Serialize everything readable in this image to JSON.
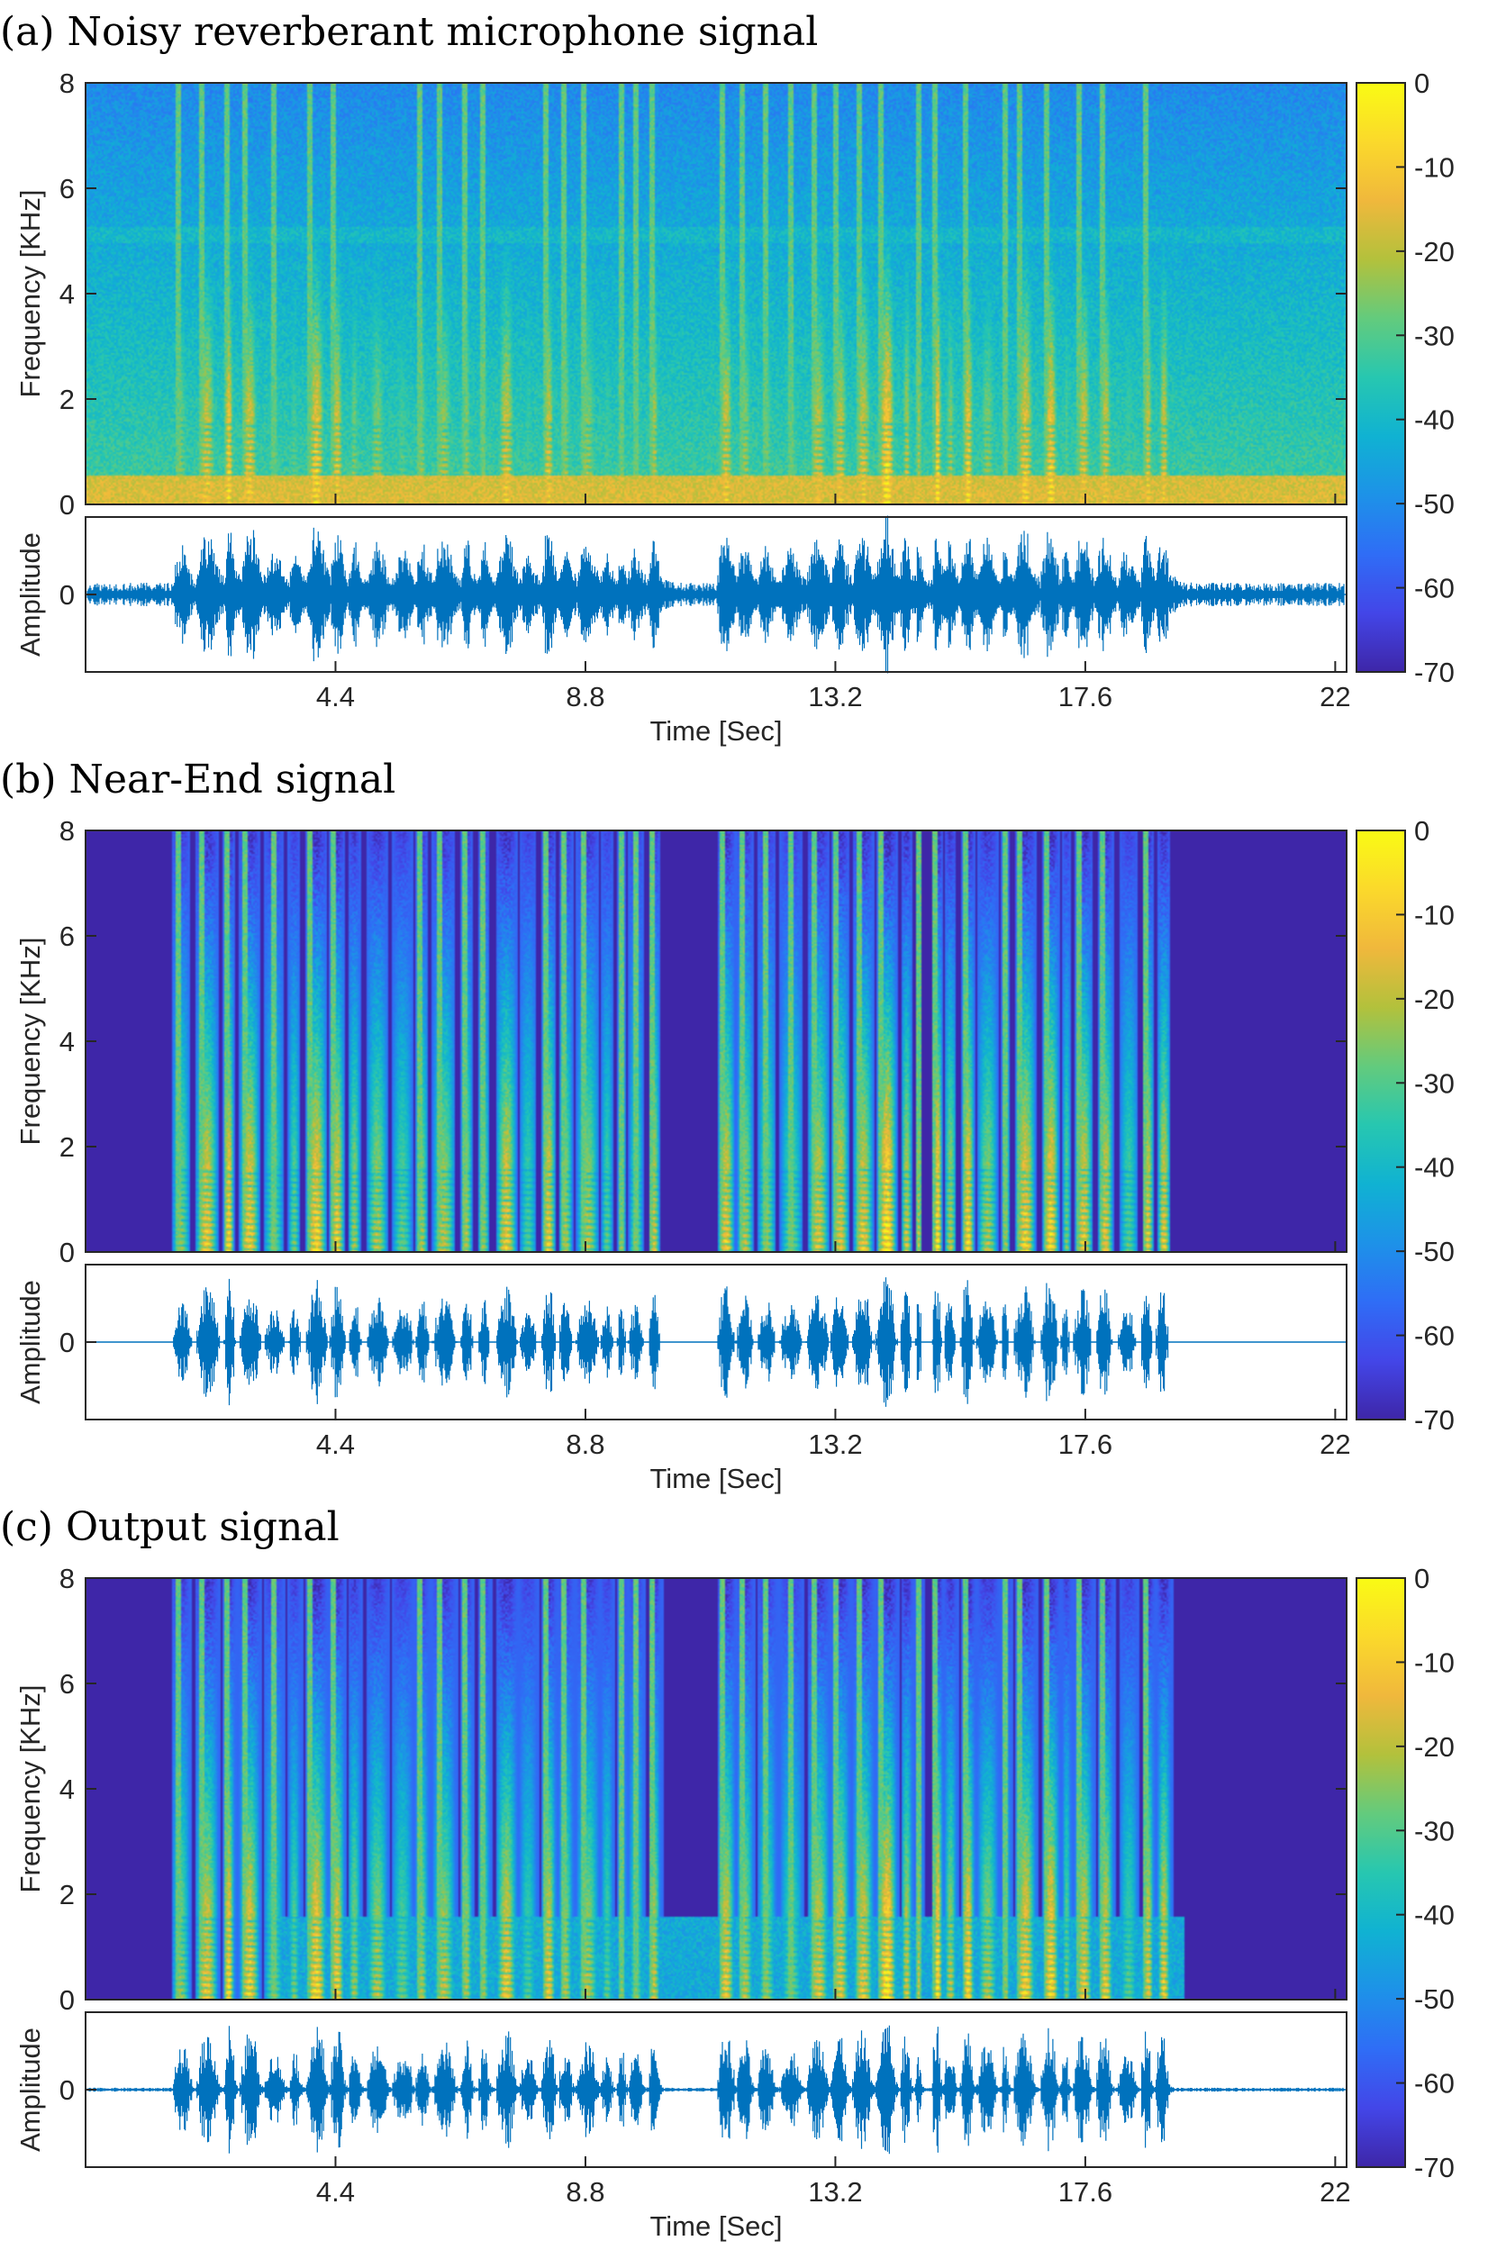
{
  "chart_data": [
    {
      "type": "spectrogram_with_waveform",
      "title": "(a)  Noisy reverberant microphone signal",
      "spectrogram": {
        "ylabel": "Frequency [KHz]",
        "ylim": [
          0,
          8
        ],
        "yticks": [
          "0",
          "2",
          "4",
          "6",
          "8"
        ],
        "background_db": -50,
        "noise_floor": true,
        "noise_level": 0.3,
        "reverb_tail": 0.7,
        "high_freq_noise_band": true
      },
      "waveform": {
        "ylabel": "Amplitude",
        "yticks": [
          "0"
        ],
        "noise_amplitude": 0.12,
        "reverb_tail": 0.7
      },
      "xlabel": "Time [Sec]",
      "xlim": [
        0,
        22.2
      ],
      "xticks": [
        "4.4",
        "8.8",
        "13.2",
        "17.6",
        "22"
      ],
      "colorbar": {
        "ticks": [
          "0",
          "-10",
          "-20",
          "-30",
          "-40",
          "-50",
          "-60",
          "-70"
        ],
        "clim": [
          -70,
          0
        ]
      }
    },
    {
      "type": "spectrogram_with_waveform",
      "title": "(b)  Near-End signal",
      "spectrogram": {
        "ylabel": "Frequency [KHz]",
        "ylim": [
          0,
          8
        ],
        "yticks": [
          "0",
          "2",
          "4",
          "6",
          "8"
        ],
        "background_db": -70,
        "noise_floor": false,
        "noise_level": 0.0,
        "reverb_tail": 0.0,
        "high_freq_noise_band": false
      },
      "waveform": {
        "ylabel": "Amplitude",
        "yticks": [
          "0"
        ],
        "noise_amplitude": 0.0,
        "reverb_tail": 0.0
      },
      "xlabel": "Time [Sec]",
      "xlim": [
        0,
        22.2
      ],
      "xticks": [
        "4.4",
        "8.8",
        "13.2",
        "17.6",
        "22"
      ],
      "colorbar": {
        "ticks": [
          "0",
          "-10",
          "-20",
          "-30",
          "-40",
          "-50",
          "-60",
          "-70"
        ],
        "clim": [
          -70,
          0
        ]
      }
    },
    {
      "type": "spectrogram_with_waveform",
      "title": "(c)  Output signal",
      "spectrogram": {
        "ylabel": "Frequency [KHz]",
        "ylim": [
          0,
          8
        ],
        "yticks": [
          "0",
          "2",
          "4",
          "6",
          "8"
        ],
        "background_db": -70,
        "noise_floor": false,
        "noise_level": 0.1,
        "reverb_tail": 0.35,
        "high_freq_noise_band": false,
        "residual_low_band": true
      },
      "waveform": {
        "ylabel": "Amplitude",
        "yticks": [
          "0"
        ],
        "noise_amplitude": 0.02,
        "reverb_tail": 0.3
      },
      "xlabel": "Time [Sec]",
      "xlim": [
        0,
        22.2
      ],
      "xticks": [
        "4.4",
        "8.8",
        "13.2",
        "17.6",
        "22"
      ],
      "colorbar": {
        "ticks": [
          "0",
          "-10",
          "-20",
          "-30",
          "-40",
          "-50",
          "-60",
          "-70"
        ],
        "clim": [
          -70,
          0
        ]
      }
    }
  ],
  "speech_segments_sec": [
    [
      1.5,
      7.1
    ],
    [
      7.2,
      10.1
    ],
    [
      11.1,
      14.7
    ],
    [
      14.9,
      19.1
    ]
  ],
  "colormap": [
    "#3e26a8",
    "#4346e8",
    "#2f6df6",
    "#1d92e8",
    "#10b2d2",
    "#27c7b0",
    "#63cb7d",
    "#b3c13c",
    "#f0b83c",
    "#fbd92b",
    "#f9fb14"
  ]
}
